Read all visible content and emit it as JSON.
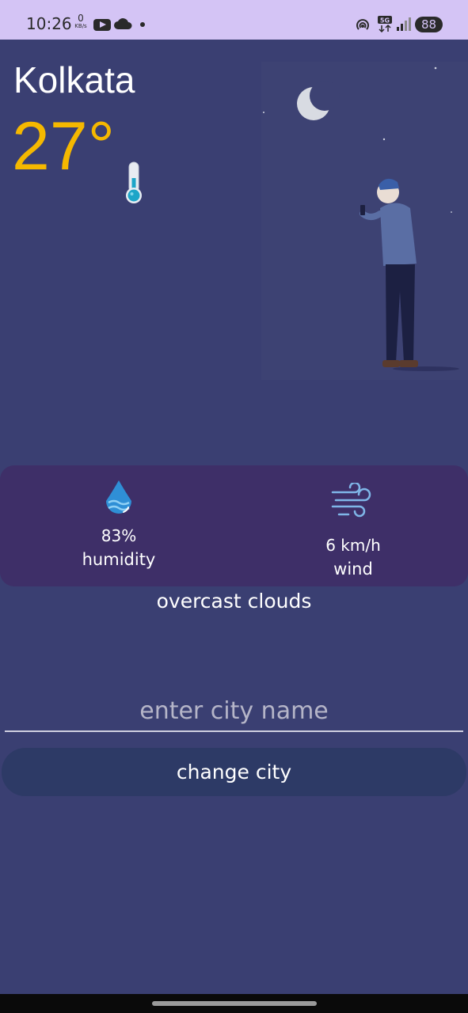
{
  "status_bar": {
    "time": "10:26",
    "net_speed_value": "0",
    "net_speed_unit": "KB/s",
    "network_type": "5G",
    "battery": "88"
  },
  "weather": {
    "city": "Kolkata",
    "temperature": "27°",
    "humidity_value": "83%",
    "humidity_label": "humidity",
    "wind_value": "6 km/h",
    "wind_label": "wind",
    "description": "overcast clouds"
  },
  "form": {
    "city_input_placeholder": "enter city name",
    "city_input_value": "",
    "change_button_label": "change city"
  },
  "colors": {
    "background": "#3a3f72",
    "temperature": "#f5b800",
    "stats_panel": "#3e2f68",
    "button": "#2d3a66",
    "status_bar": "#d4c4f5"
  },
  "icons": [
    "thermometer-icon",
    "water-drop-icon",
    "wind-icon",
    "moon-icon",
    "youtube-icon",
    "cloud-icon",
    "hotspot-icon",
    "signal-icon",
    "battery-icon"
  ]
}
